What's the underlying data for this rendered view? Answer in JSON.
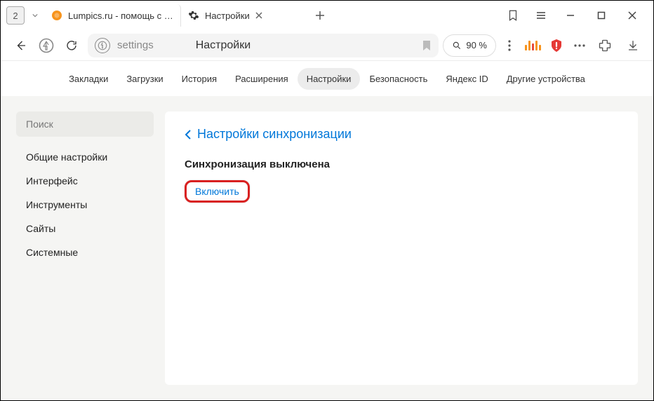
{
  "tabs": {
    "counter": "2",
    "items": [
      {
        "title": "Lumpics.ru - помощь с ком"
      },
      {
        "title": "Настройки"
      }
    ]
  },
  "address": {
    "path": "settings",
    "title": "Настройки",
    "zoom": "90 %"
  },
  "settings_tabs": [
    "Закладки",
    "Загрузки",
    "История",
    "Расширения",
    "Настройки",
    "Безопасность",
    "Яндекс ID",
    "Другие устройства"
  ],
  "sidebar": {
    "search_placeholder": "Поиск",
    "items": [
      "Общие настройки",
      "Интерфейс",
      "Инструменты",
      "Сайты",
      "Системные"
    ]
  },
  "main": {
    "breadcrumb": "Настройки синхронизации",
    "sync_title": "Синхронизация выключена",
    "enable_label": "Включить"
  }
}
